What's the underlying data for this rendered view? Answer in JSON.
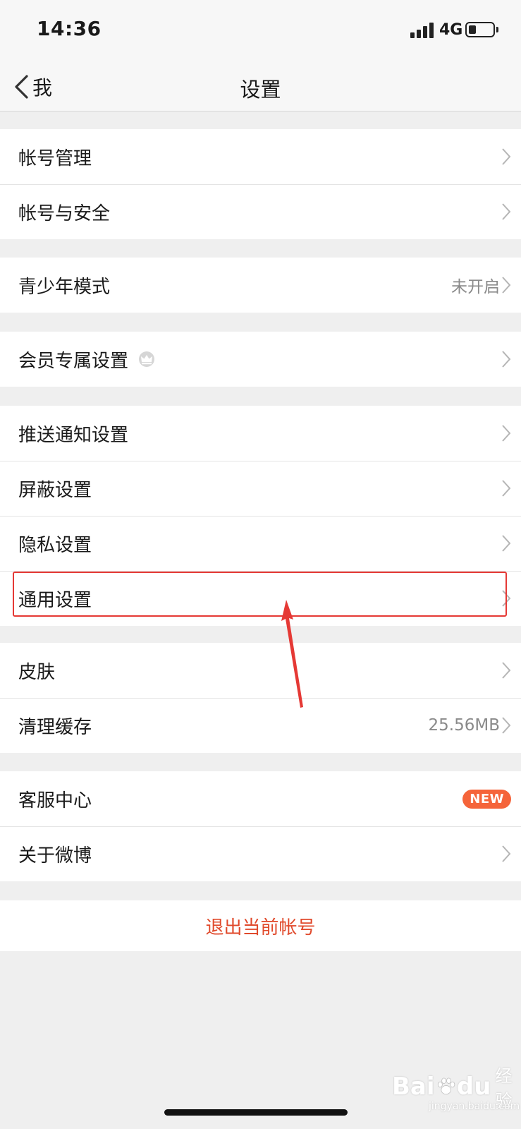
{
  "status_bar": {
    "time": "14:36",
    "network": "4G",
    "battery_level": 0.3
  },
  "nav": {
    "back_label": "我",
    "title": "设置"
  },
  "groups": [
    [
      {
        "label": "帐号管理"
      },
      {
        "label": "帐号与安全"
      }
    ],
    [
      {
        "label": "青少年模式",
        "value": "未开启"
      }
    ],
    [
      {
        "label": "会员专属设置",
        "icon": "crown-icon"
      }
    ],
    [
      {
        "label": "推送通知设置"
      },
      {
        "label": "屏蔽设置"
      },
      {
        "label": "隐私设置"
      },
      {
        "label": "通用设置",
        "highlighted": true
      }
    ],
    [
      {
        "label": "皮肤"
      },
      {
        "label": "清理缓存",
        "value": "25.56MB"
      }
    ],
    [
      {
        "label": "客服中心",
        "badge": "NEW"
      },
      {
        "label": "关于微博"
      }
    ]
  ],
  "logout_label": "退出当前帐号",
  "watermark": {
    "bai": "Bai",
    "du": "du",
    "jingyan": "经验",
    "url": "jingyan.baidu.com"
  },
  "colors": {
    "accent": "#e0492b",
    "badge": "#f5643a",
    "highlight": "#e53935"
  }
}
